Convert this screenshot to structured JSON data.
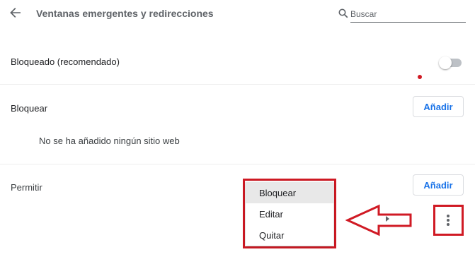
{
  "header": {
    "title": "Ventanas emergentes y redirecciones",
    "back_icon": "arrow-back-icon",
    "search": {
      "placeholder": "Buscar",
      "value": "",
      "icon": "search-icon"
    }
  },
  "settings": {
    "blocked_label": "Bloqueado (recomendado)",
    "toggle_on": false,
    "colors": {
      "accent": "#1a73e8",
      "annotation": "#d01a24"
    }
  },
  "block_section": {
    "label": "Bloquear",
    "add_label": "Añadir",
    "empty_message": "No se ha añadido ningún sitio web"
  },
  "allow_section": {
    "label": "Permitir",
    "add_label": "Añadir"
  },
  "context_menu": {
    "items": [
      {
        "label": "Bloquear"
      },
      {
        "label": "Editar"
      },
      {
        "label": "Quitar"
      }
    ]
  },
  "more_actions_icon": "more-vert-icon"
}
